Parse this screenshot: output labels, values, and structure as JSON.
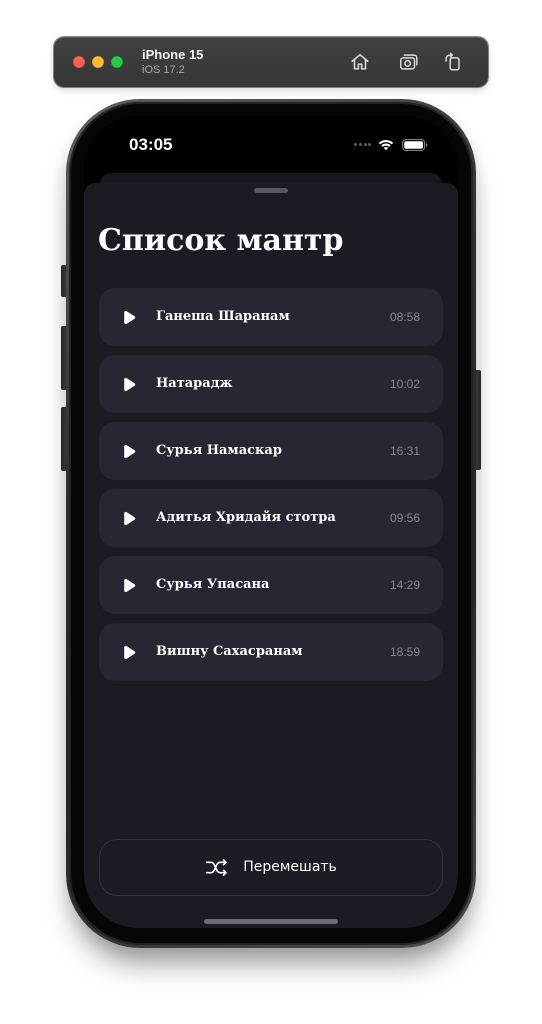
{
  "simulator": {
    "device_name": "iPhone 15",
    "os_version": "iOS 17.2",
    "toolbar_icons": [
      "home-icon",
      "screenshot-icon",
      "rotate-icon"
    ]
  },
  "status_bar": {
    "time": "03:05",
    "icons": [
      "signal-dots-icon",
      "wifi-icon",
      "battery-icon"
    ]
  },
  "sheet": {
    "title": "Список мантр",
    "mantras": [
      {
        "title": "Ганеша Шаранам",
        "duration": "08:58",
        "icon": "play-icon"
      },
      {
        "title": "Натарадж",
        "duration": "10:02",
        "icon": "play-icon"
      },
      {
        "title": "Сурья Намаскар",
        "duration": "16:31",
        "icon": "play-icon"
      },
      {
        "title": "Адитья Хридайя стотра",
        "duration": "09:56",
        "icon": "play-icon"
      },
      {
        "title": "Сурья Упасана",
        "duration": "14:29",
        "icon": "play-icon"
      },
      {
        "title": "Вишну Сахасранам",
        "duration": "18:59",
        "icon": "play-icon"
      }
    ],
    "shuffle_button": {
      "label": "Перемешать",
      "icon": "shuffle-icon"
    }
  },
  "colors": {
    "page_bg": "#ffffff",
    "toolbar_bg": "#363636",
    "traffic_red": "#ff5f57",
    "traffic_yellow": "#febc2e",
    "traffic_green": "#28c840",
    "screen_bg": "#000000",
    "sheet_bg": "#1e1a24",
    "row_bg": "#2a2532",
    "button_border": "#37323e",
    "grabber": "#5a5660",
    "text_primary": "#ffffff",
    "text_secondary": "#8a8590"
  }
}
